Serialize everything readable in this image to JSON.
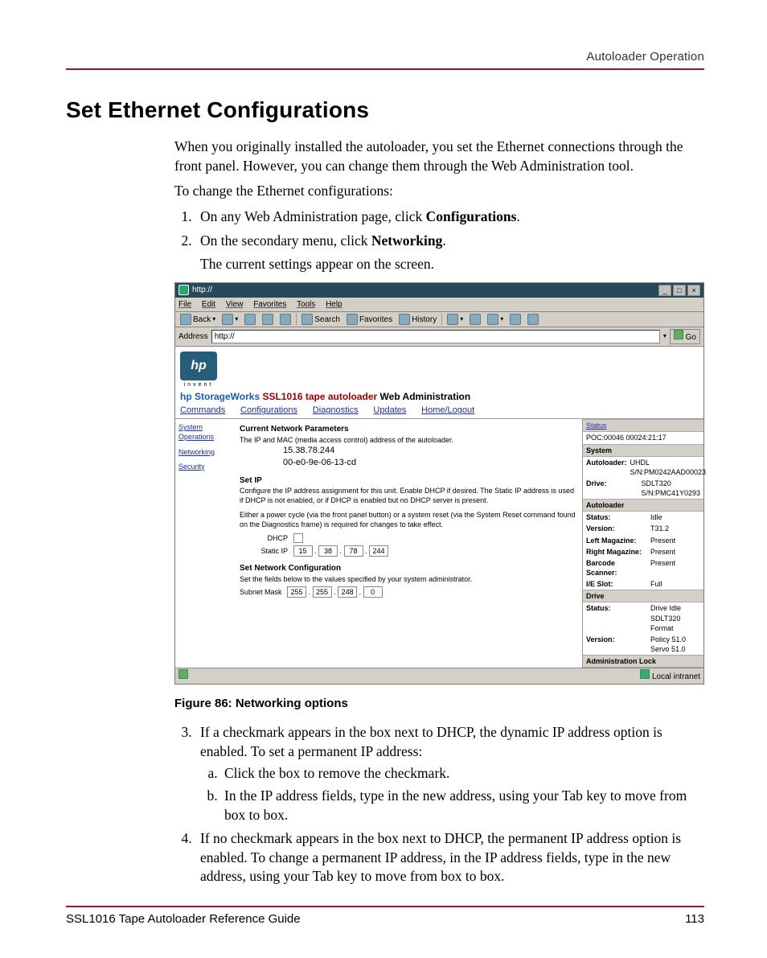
{
  "header": {
    "right": "Autoloader Operation"
  },
  "section": {
    "title": "Set Ethernet Configurations",
    "intro": "When you originally installed the autoloader, you set the Ethernet connections through the front panel. However, you can change them through the Web Administration tool.",
    "lead": "To change the Ethernet configurations:",
    "step1_a": "On any Web Administration page, click ",
    "step1_b": "Configurations",
    "step1_c": ".",
    "step2_a": "On the secondary menu, click ",
    "step2_b": "Networking",
    "step2_c": ".",
    "step2_sub": "The current settings appear on the screen.",
    "step3": "If a checkmark appears in the box next to DHCP, the dynamic IP address option is enabled. To set a permanent IP address:",
    "step3a": "Click the box to remove the checkmark.",
    "step3b": "In the IP address fields, type in the new address, using your Tab key to move from box to box.",
    "step4": "If no checkmark appears in the box next to DHCP, the permanent IP address option is enabled. To change a permanent IP address, in the IP address fields, type in the new address, using your Tab key to move from box to box."
  },
  "figure": {
    "caption": "Figure 86:  Networking options",
    "titlebar_url": "http://",
    "winbtn_min": "_",
    "winbtn_max": "□",
    "winbtn_close": "×",
    "menu": {
      "file": "File",
      "edit": "Edit",
      "view": "View",
      "favorites": "Favorites",
      "tools": "Tools",
      "help": "Help"
    },
    "toolbar": {
      "back": "Back",
      "search": "Search",
      "favorites": "Favorites",
      "history": "History"
    },
    "addr_label": "Address",
    "addr_value": "http://",
    "go": "Go",
    "logo": "hp",
    "invent": "invent",
    "apptitle": {
      "blue": "hp StorageWorks ",
      "red": "SSL1016 tape autoloader  ",
      "black": "Web Administration"
    },
    "nav": {
      "commands": "Commands",
      "configurations": "Configurations",
      "diagnostics": "Diagnostics",
      "updates": "Updates",
      "homelogout": "Home/Logout"
    },
    "side": {
      "sysops": "System Operations",
      "networking": "Networking",
      "security": "Security"
    },
    "main": {
      "h1": "Current Network Parameters",
      "h1_desc": "The IP and MAC (media access control) address of the autoloader.",
      "ip": "15.38.78.244",
      "mac": "00-e0-9e-06-13-cd",
      "h2": "Set IP",
      "h2_desc1": "Configure the IP address assignment for this unit. Enable DHCP if desired. The Static IP address is used if DHCP is not enabled, or if DHCP is enabled but no DHCP server is present.",
      "h2_desc2": "Either a power cycle (via the front panel button) or a system reset (via the System Reset command found on the Diagnostics frame) is required for changes to take effect.",
      "dhcp_label": "DHCP",
      "static_label": "Static IP",
      "static": [
        "15",
        "38",
        "78",
        "244"
      ],
      "h3": "Set Network Configuration",
      "h3_desc": "Set the fields below to the values specified by your system administrator.",
      "subnet_label": "Subnet Mask",
      "subnet": [
        "255",
        "255",
        "248",
        "0"
      ]
    },
    "right": {
      "status_hdr": "Status",
      "poc": "POC:00046 00024:21:17",
      "system_hdr": "System",
      "autoloader_k": "Autoloader:",
      "autoloader_v": "UHDL S/N:PM0242AAD00023",
      "drive_k": "Drive:",
      "drive_v": "SDLT320 S/N:PMC41Y0293",
      "autoloader_hdr": "Autoloader",
      "status_k": "Status:",
      "status_v": "Idle",
      "version_k": "Version:",
      "version_v": "T31.2",
      "leftmag_k": "Left Magazine:",
      "leftmag_v": "Present",
      "rightmag_k": "Right Magazine:",
      "rightmag_v": "Present",
      "barcode_k": "Barcode Scanner:",
      "barcode_v": "Present",
      "ieslot_k": "I/E Slot:",
      "ieslot_v": "Full",
      "drive_hdr": "Drive",
      "dstatus_k": "Status:",
      "dstatus_v": "Drive Idle SDLT320 Format",
      "dversion_k": "Version:",
      "dversion_v": "Policy 51.0 Servo 51.0",
      "adminlock_hdr": "Administration Lock"
    },
    "statusbar_right": "Local intranet"
  },
  "footer": {
    "left": "SSL1016 Tape Autoloader Reference Guide",
    "right": "113"
  }
}
